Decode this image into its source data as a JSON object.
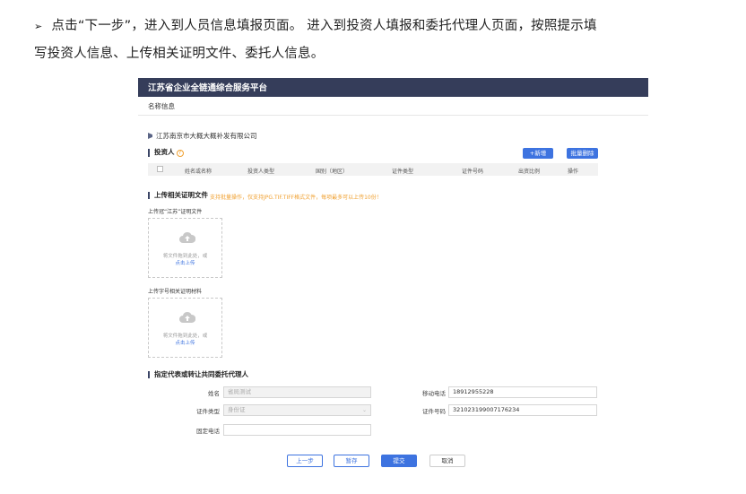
{
  "instructions": {
    "bullet": "➢",
    "line1": "点击“下一步”，进入到人员信息填报页面。 进入到投资人填报和委托代理人页面，按照提示填",
    "line2": "写投资人信息、上传相关证明文件、委托人信息。"
  },
  "app": {
    "brand": "江苏省企业全链通综合服务平台",
    "subheader": "名称信息",
    "company": "江苏南京市大概大概补发有限公司"
  },
  "investor": {
    "title": "投资人",
    "help_icon": "?",
    "add_button": "+新增",
    "delete_button": "批量删除",
    "columns": [
      "姓名或名称",
      "投资人类型",
      "国别（地区）",
      "证件类型",
      "证件号码",
      "出资比例",
      "操作"
    ]
  },
  "upload": {
    "title": "上传相关证明文件",
    "note": "支持批量操作，仅支持JPG.TIF.TIFF格式文件，每项最多可以上传10份！",
    "field1_label": "上传冠“江苏”证明文件",
    "field2_label": "上传字号相关证明材料",
    "drop_text": "将文件拖到此处，或",
    "drop_link": "点击上传"
  },
  "agent": {
    "title": "指定代表或转让共同委托代理人",
    "name_label": "姓名",
    "name_value": "省局测试",
    "phone_label": "移动电话",
    "phone_value": "18912955228",
    "idtype_label": "证件类型",
    "idtype_value": "身份证",
    "idno_label": "证件号码",
    "idno_value": "321023199007176234",
    "tel_label": "固定电话",
    "tel_value": ""
  },
  "footer": {
    "prev": "上一步",
    "save": "暂存",
    "submit": "提交",
    "cancel": "取消"
  },
  "colors": {
    "header": "#353d5a",
    "accent": "#3d73e0",
    "warning": "#f0a030"
  },
  "icons": [
    "flag-icon",
    "help-icon",
    "cloud-upload-icon",
    "chevron-down-icon"
  ]
}
